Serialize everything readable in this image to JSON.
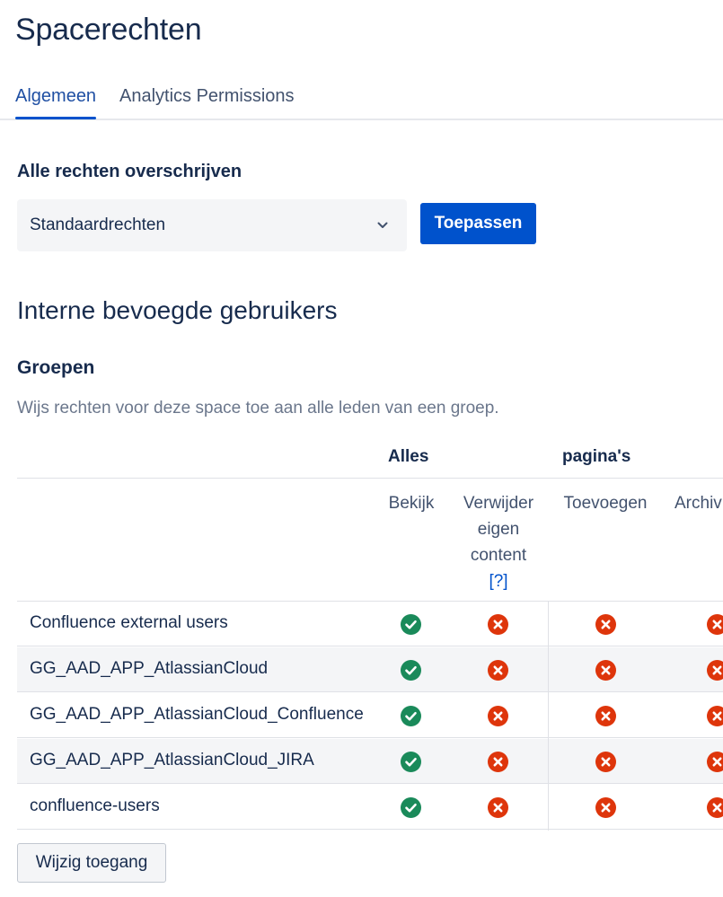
{
  "page": {
    "title": "Spacerechten"
  },
  "tabs": [
    {
      "label": "Algemeen",
      "active": true
    },
    {
      "label": "Analytics Permissions",
      "active": false
    }
  ],
  "override": {
    "label": "Alle rechten overschrijven",
    "select_value": "Standaardrechten",
    "apply_label": "Toepassen"
  },
  "section": {
    "heading": "Interne bevoegde gebruikers",
    "subheading": "Groepen",
    "description": "Wijs rechten voor deze space toe aan alle leden van een groep."
  },
  "table": {
    "group_headers": [
      "Alles",
      "pagina's"
    ],
    "columns": {
      "view": "Bekijk",
      "delete_own_line1": "Verwijder",
      "delete_own_line2": "eigen",
      "delete_own_line3": "content",
      "delete_own_help": "[?]",
      "add": "Toevoegen",
      "archive": "Archiv"
    },
    "rows": [
      {
        "name": "Confluence external users",
        "view": "granted",
        "delete_own": "denied",
        "add": "denied",
        "archive": "denied"
      },
      {
        "name": "GG_AAD_APP_AtlassianCloud",
        "view": "granted",
        "delete_own": "denied",
        "add": "denied",
        "archive": "denied"
      },
      {
        "name": "GG_AAD_APP_AtlassianCloud_Confluence",
        "view": "granted",
        "delete_own": "denied",
        "add": "denied",
        "archive": "denied"
      },
      {
        "name": "GG_AAD_APP_AtlassianCloud_JIRA",
        "view": "granted",
        "delete_own": "denied",
        "add": "denied",
        "archive": "denied"
      },
      {
        "name": "confluence-users",
        "view": "granted",
        "delete_own": "denied",
        "add": "denied",
        "archive": "denied"
      }
    ]
  },
  "actions": {
    "edit_access_label": "Wijzig toegang"
  },
  "icons": {
    "granted": "check-circle-icon",
    "denied": "cross-circle-icon",
    "select_chevron": "chevron-down-icon"
  },
  "colors": {
    "primary": "#0052cc",
    "granted": "#1a8a5a",
    "denied": "#de350b",
    "text": "#172b4d",
    "subtle_text": "#6b778c"
  }
}
